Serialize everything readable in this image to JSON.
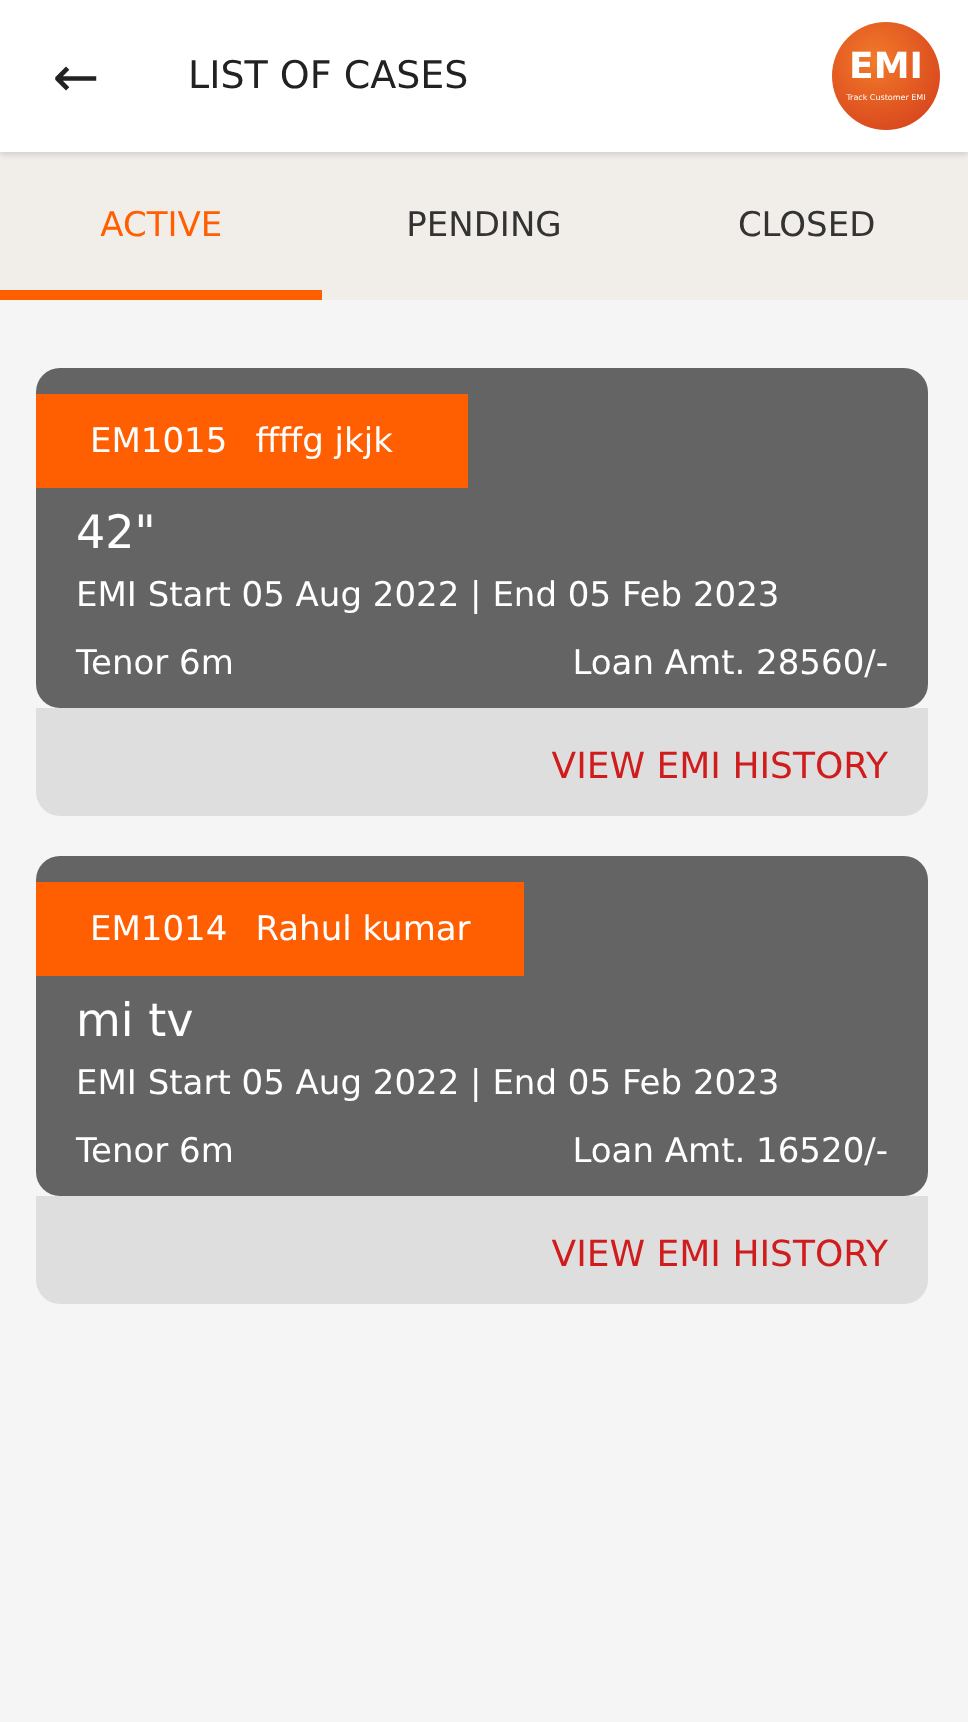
{
  "header": {
    "title": "LIST OF CASES",
    "back_icon": "←",
    "logo": {
      "text": "EMI",
      "tagline": "Track Customer EMI"
    }
  },
  "tabs": [
    {
      "label": "ACTIVE",
      "selected": true
    },
    {
      "label": "PENDING",
      "selected": false
    },
    {
      "label": "CLOSED",
      "selected": false
    }
  ],
  "cases": [
    {
      "id": "EM1015",
      "name": "ffffg jkjk",
      "product": "42\"",
      "dates": "EMI Start 05 Aug 2022 | End  05 Feb 2023",
      "tenor": "Tenor 6m",
      "loan": "Loan Amt. 28560/-",
      "action": "VIEW EMI HISTORY"
    },
    {
      "id": "EM1014",
      "name": "Rahul kumar",
      "product": "mi tv",
      "dates": "EMI Start 05 Aug 2022 | End  05 Feb 2023",
      "tenor": "Tenor 6m",
      "loan": "Loan Amt. 16520/-",
      "action": "VIEW EMI HISTORY"
    }
  ]
}
